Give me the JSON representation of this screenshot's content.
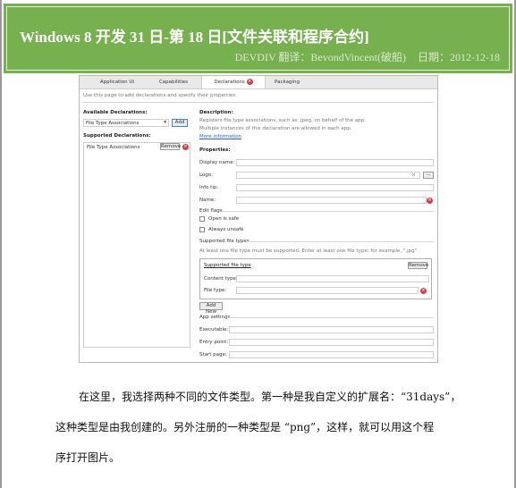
{
  "header": {
    "title": "Windows 8 开发 31 日-第 18 日[文件关联和程序合约]",
    "source": "DEVDIV 翻译：BevondVincent(破船)",
    "date": "日期：2012-12-18",
    "colors": {
      "banner": "#77b04e",
      "text": "#ffffff"
    }
  },
  "screenshot": {
    "tabs": [
      "Application UI",
      "Capabilities",
      "Declarations",
      "Packaging"
    ],
    "active_tab": "Declarations",
    "intro": "Use this page to add declarations and specify their properties.",
    "available_label": "Available Declarations:",
    "available_value": "File Type Associations",
    "add_label": "Add",
    "supported_label": "Supported Declarations:",
    "supported_item": "File Type Associations",
    "remove_label": "Remove",
    "description_label": "Description:",
    "description_1": "Registers file type associations, such as .jpeg, on behalf of the app.",
    "description_2": "Multiple instances of this declaration are allowed in each app.",
    "more_info": "More information",
    "properties_label": "Properties:",
    "display_name": "Display name:",
    "logo": "Logo:",
    "logo_btn": "...",
    "info_tip": "Info tip:",
    "name": "Name:",
    "edit_flags": "Edit flags",
    "open_is_safe": "Open is safe",
    "always_unsafe": "Always unsafe",
    "supported_file_types": "Supported file types",
    "file_types_note": "At least one file type must be supported. Enter at least one file type; for example, \".jpg\".",
    "supported_file_type": "Supported file type",
    "content_type": "Content type:",
    "file_type": "File type:",
    "add_new": "Add New",
    "app_settings": "App settings",
    "executable": "Executable:",
    "entry_point": "Entry point:",
    "start_page": "Start page:"
  },
  "body": {
    "line1": "在这里，我选择两种不同的文件类型。第一种是我自定义的扩展名：“31days”，",
    "line2": "这种类型是由我创建的。另外注册的一种类型是 “png”，这样，就可以用这个程",
    "line3": "序打开图片。"
  }
}
